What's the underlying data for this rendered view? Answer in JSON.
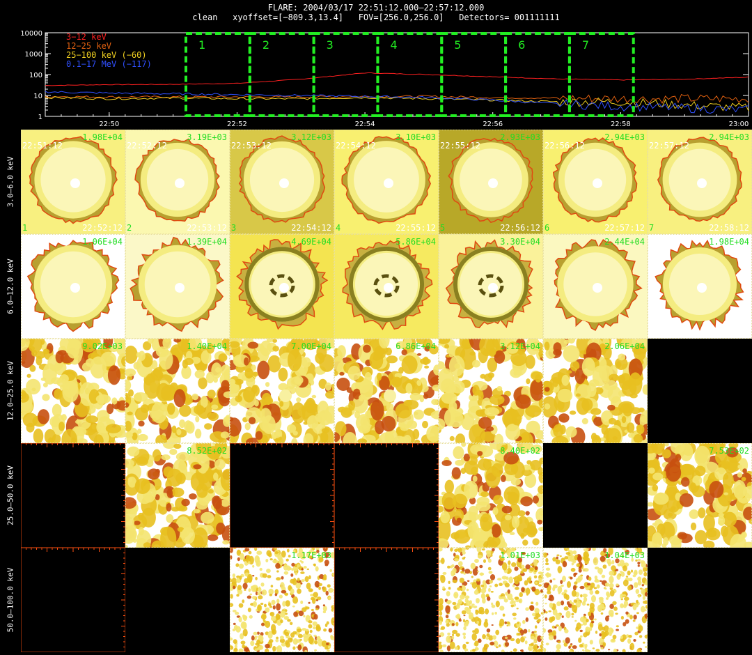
{
  "header": {
    "line1": "FLARE: 2004/03/17 22:51:12.000–22:57:12.000",
    "line2": "clean   xyoffset=[−809.3,13.4]   FOV=[256.0,256.0]   Detectors= 001111111"
  },
  "chart_data": [
    {
      "type": "line",
      "y_scale": "log",
      "ylim": [
        1,
        10000
      ],
      "y_ticks": [
        "10000",
        "1000",
        "100",
        "10",
        "1"
      ],
      "x_ticks": [
        "22:50",
        "22:52",
        "22:54",
        "22:56",
        "22:58",
        "23:00"
      ],
      "xlim": [
        "22:49",
        "23:00"
      ],
      "legend_position": "top-left",
      "series": [
        {
          "name": "3−12 keV",
          "color": "#ff2020",
          "x": [
            "22:49",
            "22:50",
            "22:51",
            "22:52",
            "22:53",
            "22:54",
            "22:55",
            "22:56",
            "22:57",
            "22:58",
            "22:59",
            "23:00"
          ],
          "values": [
            30,
            33,
            34,
            38,
            60,
            120,
            100,
            78,
            62,
            55,
            60,
            75
          ]
        },
        {
          "name": "12−25 keV",
          "color": "#e06010",
          "x": [
            "22:49",
            "22:50",
            "22:51",
            "22:52",
            "22:53",
            "22:54",
            "22:55",
            "22:56",
            "22:57",
            "22:58",
            "22:59",
            "23:00"
          ],
          "values": [
            9,
            8.5,
            8.5,
            8.5,
            8.5,
            9,
            9,
            8,
            7.5,
            7,
            7,
            7
          ]
        },
        {
          "name": "25−100 keV (−60)",
          "color": "#f0d020",
          "x": [
            "22:49",
            "22:50",
            "22:51",
            "22:52",
            "22:53",
            "22:54",
            "22:55",
            "22:56",
            "22:57",
            "22:58",
            "22:59",
            "23:00"
          ],
          "values": [
            8,
            7,
            7.5,
            7,
            7,
            8,
            7,
            6,
            5,
            5,
            3.5,
            2.5
          ]
        },
        {
          "name": "0.1−17 MeV (−117)",
          "color": "#3050ff",
          "x": [
            "22:49",
            "22:50",
            "22:51",
            "22:52",
            "22:53",
            "22:54",
            "22:55",
            "22:56",
            "22:57",
            "22:58",
            "22:59",
            "23:00"
          ],
          "values": [
            15,
            13,
            12,
            11,
            10,
            9,
            8,
            6,
            4,
            3,
            2.5,
            2
          ]
        }
      ],
      "time_intervals": [
        {
          "label": "1",
          "start": "22:51:12",
          "end": "22:52:12"
        },
        {
          "label": "2",
          "start": "22:52:12",
          "end": "22:53:12"
        },
        {
          "label": "3",
          "start": "22:53:12",
          "end": "22:54:12"
        },
        {
          "label": "4",
          "start": "22:54:12",
          "end": "22:55:12"
        },
        {
          "label": "5",
          "start": "22:55:12",
          "end": "22:56:12"
        },
        {
          "label": "6",
          "start": "22:56:12",
          "end": "22:57:12"
        },
        {
          "label": "7",
          "start": "22:57:12",
          "end": "22:58:12"
        }
      ],
      "interval_color": "#22ee22"
    },
    {
      "type": "heatmap",
      "rows": [
        "3.0–6.0 keV",
        "6.0–12.0 keV",
        "12.0–25.0 keV",
        "25.0–50.0 keV",
        "50.0–100.0 keV"
      ],
      "columns": [
        "1",
        "2",
        "3",
        "4",
        "5",
        "6",
        "7"
      ],
      "start_times": [
        "22:51:12",
        "22:52:12",
        "22:53:12",
        "22:54:12",
        "22:55:12",
        "22:56:12",
        "22:57:12"
      ],
      "end_times": [
        "22:52:12",
        "22:53:12",
        "22:54:12",
        "22:55:12",
        "22:56:12",
        "22:57:12",
        "22:58:12"
      ],
      "peak_values": [
        [
          "1.98E+04",
          "3.19E+03",
          "3.12E+03",
          "3.10E+03",
          "2.93E+03",
          "2.94E+03",
          "2.94E+03"
        ],
        [
          "1.06E+04",
          "1.39E+04",
          "4.69E+04",
          "5.86E+04",
          "3.30E+04",
          "2.44E+04",
          "1.98E+04"
        ],
        [
          "9.02E+03",
          "1.40E+04",
          "7.00E+04",
          "6.86E+04",
          "3.12E+04",
          "2.06E+04",
          null
        ],
        [
          null,
          "8.52E+02",
          null,
          null,
          "8.40E+02",
          null,
          "7.53E+02"
        ],
        [
          null,
          null,
          "1.17E+03",
          null,
          "1.01E+03",
          "1.04E+03",
          null
        ]
      ],
      "panel_kind": [
        [
          "disk",
          "disk",
          "disk",
          "disk",
          "disk",
          "disk",
          "disk"
        ],
        [
          "disk",
          "disk",
          "ring",
          "ring",
          "ring",
          "disk",
          "disk"
        ],
        [
          "patchy",
          "patchy",
          "patchy",
          "patchy",
          "patchy",
          "patchy",
          "empty"
        ],
        [
          "empty",
          "patchy",
          "empty",
          "empty",
          "patchy",
          "empty",
          "patchy"
        ],
        [
          "empty",
          "empty",
          "noise",
          "empty",
          "noise",
          "noise",
          "empty"
        ]
      ],
      "panel_background": [
        [
          "#f8f080",
          "#fbf8b0",
          "#d8c848",
          "#f8f070",
          "#b8a828",
          "#f8f070",
          "#f8f080"
        ],
        [
          "#ffffff",
          "#fbf8c8",
          "#f4e450",
          "#f6ea60",
          "#faf29a",
          "#fbf8c0",
          "#ffffff"
        ],
        [
          "#ffffff",
          "#ffffff",
          "#ffffff",
          "#ffffff",
          "#ffffff",
          "#ffffff",
          "#000000"
        ],
        [
          "#000000",
          "#ffffff",
          "#000000",
          "#000000",
          "#ffffff",
          "#000000",
          "#ffffff"
        ],
        [
          "#000000",
          "#000000",
          "#ffffff",
          "#000000",
          "#ffffff",
          "#ffffff",
          "#000000"
        ]
      ],
      "axis_color": "#ff5010",
      "peak_label_color": "#22dd22"
    }
  ]
}
